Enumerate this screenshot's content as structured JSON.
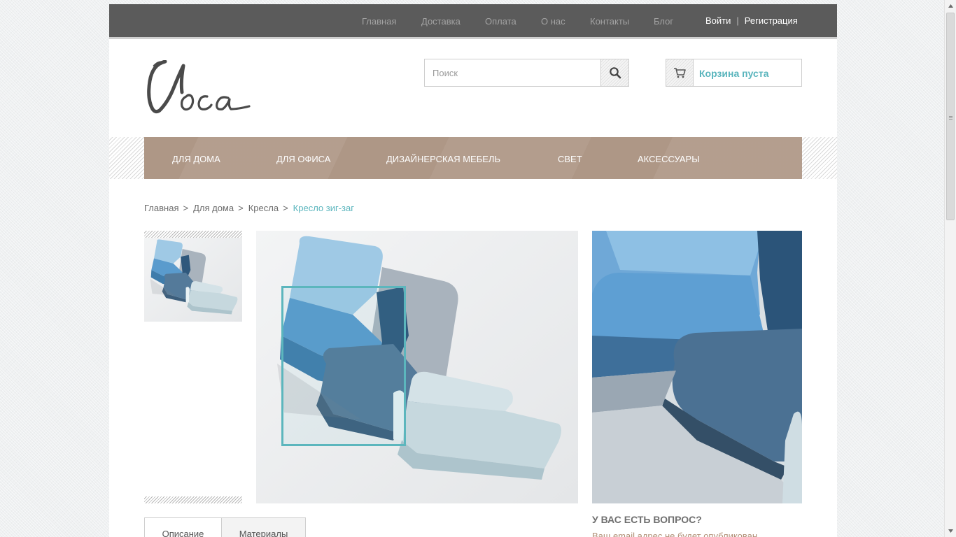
{
  "colors": {
    "accent": "#5ab5bd",
    "topbar": "#5b5b5b",
    "nav_background": "#ae9786",
    "question_text": "#b08f76"
  },
  "topnav": {
    "items": [
      {
        "label": "Главная"
      },
      {
        "label": "Доставка"
      },
      {
        "label": "Оплата"
      },
      {
        "label": "О нас"
      },
      {
        "label": "Контакты"
      },
      {
        "label": "Блог"
      }
    ],
    "login_label": "Войти",
    "separator": "|",
    "register_label": "Регистрация"
  },
  "header": {
    "logo_text": "Voca",
    "search": {
      "placeholder": "Поиск",
      "value": "",
      "icon": "search-icon"
    },
    "cart": {
      "label": "Корзина пуста",
      "icon": "cart-icon"
    }
  },
  "mainnav": {
    "items": [
      {
        "label": "ДЛЯ ДОМА"
      },
      {
        "label": "ДЛЯ ОФИСА"
      },
      {
        "label": "ДИЗАЙНЕРСКАЯ МЕБЕЛЬ"
      },
      {
        "label": "СВЕТ"
      },
      {
        "label": "АКСЕССУАРЫ"
      }
    ]
  },
  "breadcrumb": {
    "items": [
      {
        "label": "Главная"
      },
      {
        "label": "Для дома"
      },
      {
        "label": "Кресла"
      }
    ],
    "separator": ">",
    "current": "Кресло зиг-заг"
  },
  "product": {
    "image_subject": "blue zig-zag armchair photo"
  },
  "tabs": [
    {
      "label": "Описание"
    },
    {
      "label": "Материалы"
    }
  ],
  "question": {
    "title": "У ВАС ЕСТЬ ВОПРОС?",
    "note": "Ваш email адрес не будет опубликован"
  }
}
